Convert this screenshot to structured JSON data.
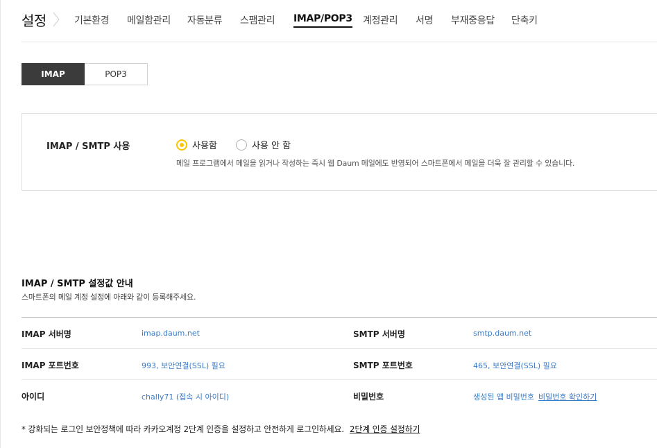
{
  "header": {
    "title": "설정",
    "tabs": [
      {
        "label": "기본환경",
        "active": false
      },
      {
        "label": "메일함관리",
        "active": false
      },
      {
        "label": "자동분류",
        "active": false
      },
      {
        "label": "스팸관리",
        "active": false
      },
      {
        "label": "IMAP/POP3",
        "active": true
      },
      {
        "label": "계정관리",
        "active": false
      },
      {
        "label": "서명",
        "active": false
      },
      {
        "label": "부재중응답",
        "active": false
      },
      {
        "label": "단축키",
        "active": false
      }
    ]
  },
  "segment": {
    "imap_label": "IMAP",
    "pop3_label": "POP3",
    "selected": "IMAP"
  },
  "imap_setting": {
    "label": "IMAP / SMTP 사용",
    "option_on": "사용함",
    "option_off": "사용 안 함",
    "selected": "사용함",
    "description": "메일 프로그램에서 메일을 읽거나 작성하는 즉시 웹 Daum 메일에도 반영되어 스마트폰에서 메일을 더욱 잘 관리할 수 있습니다."
  },
  "info": {
    "title": "IMAP / SMTP 설정값 안내",
    "subtitle": "스마트폰의 메일 계정 설정에 아래와 같이 등록해주세요.",
    "rows": [
      {
        "k1": "IMAP 서버명",
        "v1": "imap.daum.net",
        "k2": "SMTP 서버명",
        "v2": "smtp.daum.net"
      },
      {
        "k1": "IMAP 포트번호",
        "v1": "993, 보안연결(SSL) 필요",
        "k2": "SMTP 포트번호",
        "v2": "465, 보안연결(SSL) 필요"
      },
      {
        "k1": "아이디",
        "v1": "chally71 (접속 시 아이디)",
        "k2": "비밀번호",
        "v2": "생성된 앱 비밀번호",
        "link": "비밀번호 확인하기"
      }
    ]
  },
  "note": {
    "text": "* 강화되는 로그인 보안정책에 따라 카카오계정 2단계 인증을 설정하고 안전하게 로그인하세요.",
    "link": "2단계 인증 설정하기"
  },
  "colors": {
    "accent_radio": "#f7c600",
    "link_blue": "#3a7bc8",
    "segment_active": "#3b3b3b"
  }
}
